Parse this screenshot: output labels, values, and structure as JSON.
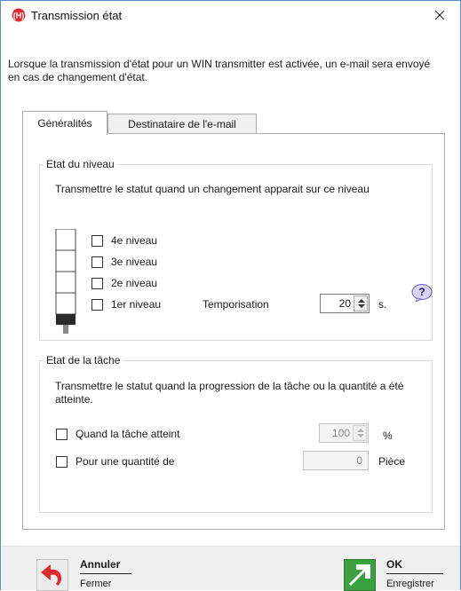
{
  "window": {
    "title": "Transmission état"
  },
  "description": "Lorsque la transmission d'état pour un WIN transmitter est activée, un e-mail sera envoyé en cas de changement d'état.",
  "tabs": [
    {
      "label": "Généralités",
      "active": true
    },
    {
      "label": "Destinataire de l'e-mail",
      "active": false
    }
  ],
  "level_group": {
    "legend": "Etat du niveau",
    "text": "Transmettre le statut quand un changement apparait sur ce niveau",
    "levels": [
      {
        "label": "4e niveau",
        "checked": false
      },
      {
        "label": "3e niveau",
        "checked": false
      },
      {
        "label": "2e niveau",
        "checked": false
      },
      {
        "label": "1er niveau",
        "checked": false
      }
    ],
    "delay_label": "Temporisation",
    "delay_value": "20",
    "delay_unit": "s.",
    "help_icon": "question-bubble-icon"
  },
  "task_group": {
    "legend": "Etat de la tâche",
    "text": "Transmettre le statut quand la progression de la tâche ou la quantité a été atteinte.",
    "reach_label": "Quand la tâche atteint",
    "reach_value": "100",
    "reach_unit": "%",
    "quantity_label": "Pour une quantité de",
    "quantity_value": "0",
    "quantity_unit": "Pièce"
  },
  "footer": {
    "cancel": {
      "label": "Annuler",
      "sub": "Fermer",
      "icon": "undo-arrow-icon"
    },
    "ok": {
      "label": "OK",
      "sub": "Enregistrer",
      "icon": "save-arrow-icon"
    }
  },
  "colors": {
    "accent": "#5b8fd0",
    "cancel": "#e0282f",
    "ok": "#3aa040"
  }
}
